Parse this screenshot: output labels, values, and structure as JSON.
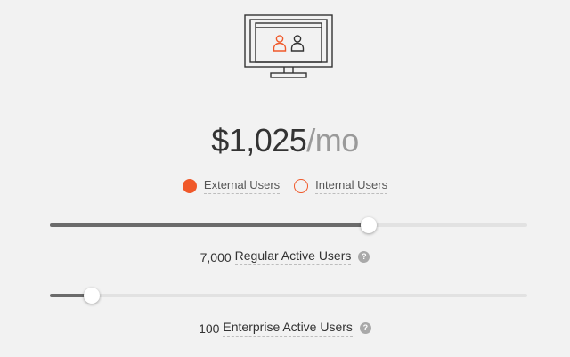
{
  "header": {
    "icon": "monitor-users-icon"
  },
  "pricing": {
    "amount": "$1,025",
    "period": "/mo"
  },
  "user_type": {
    "options": [
      {
        "label": "External Users",
        "selected": true
      },
      {
        "label": "Internal Users",
        "selected": false
      }
    ]
  },
  "regular_users": {
    "count": "7,000",
    "label": "Regular Active Users",
    "slider_fraction": 0.667,
    "help_icon": "question-mark-icon"
  },
  "enterprise_users": {
    "count": "100",
    "label": "Enterprise Active Users",
    "slider_fraction": 0.088,
    "help_icon": "question-mark-icon"
  },
  "colors": {
    "accent": "#f0592a",
    "text": "#333333",
    "muted": "#9a9a9a",
    "background": "#f2f2f2",
    "slider_fill": "#6b6b6b",
    "slider_track": "#e2e2e2"
  }
}
